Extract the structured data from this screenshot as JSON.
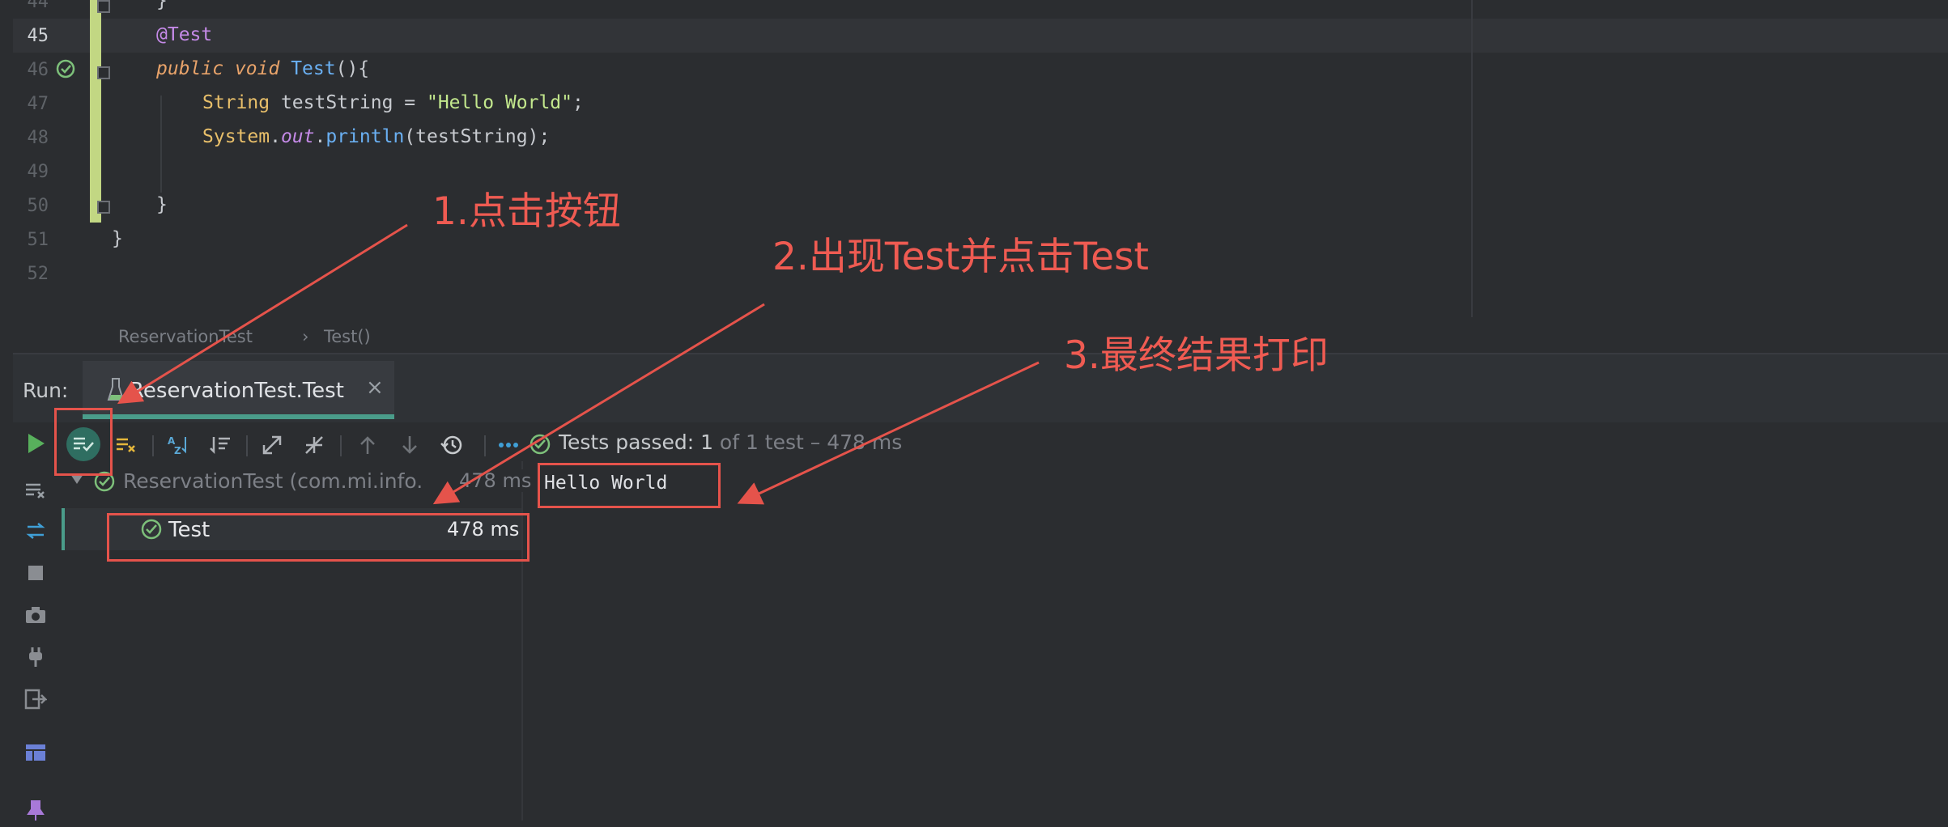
{
  "editor": {
    "lines": [
      {
        "no": "44",
        "code": "}"
      },
      {
        "no": "45",
        "code": "@Test"
      },
      {
        "no": "46",
        "code": "public void Test(){"
      },
      {
        "no": "47",
        "code": "String testString = \"Hello World\";"
      },
      {
        "no": "48",
        "code": "System.out.println(testString);"
      },
      {
        "no": "49",
        "code": ""
      },
      {
        "no": "50",
        "code": "}"
      },
      {
        "no": "51",
        "code": "}"
      },
      {
        "no": "52",
        "code": ""
      }
    ],
    "tokens": {
      "l44_brace": "}",
      "l45_annotation": "@Test",
      "l46_public": "public",
      "l46_void": "void",
      "l46_name": "Test",
      "l46_tail": "(){",
      "l47_type": "String",
      "l47_var": " testString = ",
      "l47_str": "\"Hello World\"",
      "l47_semi": ";",
      "l48_sys": "System",
      "l48_dot1": ".",
      "l48_out": "out",
      "l48_dot2": ".",
      "l48_println": "println",
      "l48_args": "(testString);",
      "l50_brace": "}",
      "l51_brace": "}"
    }
  },
  "breadcrumb": {
    "class_name": "ReservationTest",
    "separator": "›",
    "method": "Test()"
  },
  "run": {
    "label": "Run:",
    "tab_title": "ReservationTest.Test",
    "tab_close": "×",
    "status": {
      "prefix": "Tests passed: ",
      "count": "1",
      "suffix": " of 1 test – 478 ms"
    },
    "tree": {
      "root_label": "ReservationTest (com.mi.info.",
      "root_time": "478 ms",
      "child_label": "Test",
      "child_time": "478 ms"
    },
    "console_output": "Hello World"
  },
  "annotations": {
    "note1": "1.点击按钮",
    "note2": "2.出现Test并点击Test",
    "note3": "3.最终结果打印"
  },
  "colors": {
    "accent_teal": "#4a9c8a",
    "pass_green": "#7dc07a",
    "annotation_red": "#e5534b"
  }
}
